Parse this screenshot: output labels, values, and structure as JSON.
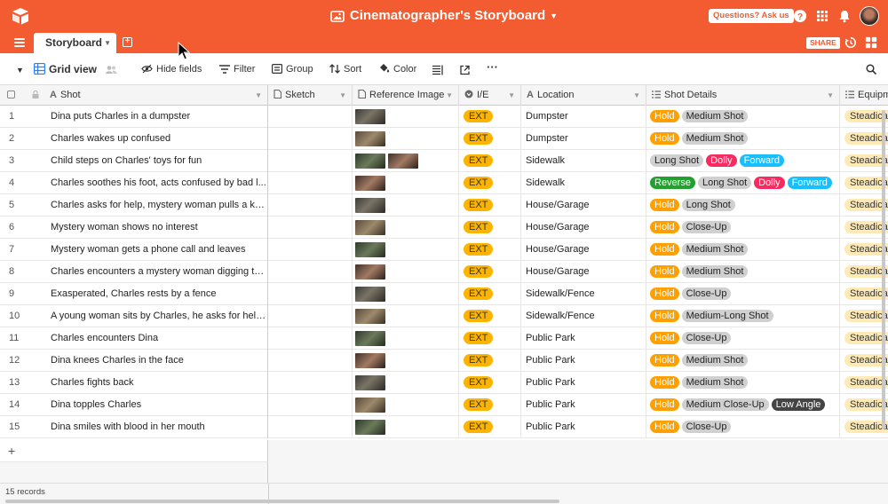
{
  "header": {
    "title": "Cinematographer's Storyboard",
    "questions_label": "Questions? Ask us",
    "share_label": "SHARE",
    "accent": "#f25c30"
  },
  "tabs": [
    {
      "label": "Storyboard"
    }
  ],
  "toolbar": {
    "view_name": "Grid view",
    "hide_fields": "Hide fields",
    "filter": "Filter",
    "group": "Group",
    "sort": "Sort",
    "color": "Color"
  },
  "columns": {
    "shot": "Shot",
    "sketch": "Sketch",
    "reference": "Reference Image",
    "ie": "I/E",
    "location": "Location",
    "details": "Shot Details",
    "equipment": "Equipm"
  },
  "rows": [
    {
      "num": "1",
      "shot": "Dina puts Charles in a dumpster",
      "ie": "EXT",
      "location": "Dumpster",
      "details": [
        {
          "text": "Hold",
          "c": "hold"
        },
        {
          "text": "Medium Shot",
          "c": "gray"
        }
      ],
      "equipment": "Steadicam",
      "thumbs": 1
    },
    {
      "num": "2",
      "shot": "Charles wakes up confused",
      "ie": "EXT",
      "location": "Dumpster",
      "details": [
        {
          "text": "Hold",
          "c": "hold"
        },
        {
          "text": "Medium Shot",
          "c": "gray"
        }
      ],
      "equipment": "Steadicam",
      "thumbs": 1
    },
    {
      "num": "3",
      "shot": "Child steps on Charles' toys for fun",
      "ie": "EXT",
      "location": "Sidewalk",
      "details": [
        {
          "text": "Long Shot",
          "c": "gray"
        },
        {
          "text": "Dolly",
          "c": "dolly"
        },
        {
          "text": "Forward",
          "c": "forward"
        }
      ],
      "equipment": "Steadicam",
      "thumbs": 2
    },
    {
      "num": "4",
      "shot": "Charles soothes his foot, acts confused by bad l...",
      "ie": "EXT",
      "location": "Sidewalk",
      "details": [
        {
          "text": "Reverse",
          "c": "reverse"
        },
        {
          "text": "Long Shot",
          "c": "gray"
        },
        {
          "text": "Dolly",
          "c": "dolly"
        },
        {
          "text": "Forward",
          "c": "forward"
        }
      ],
      "equipment": "Steadicam",
      "thumbs": 1
    },
    {
      "num": "5",
      "shot": "Charles asks for help, mystery woman pulls a kn...",
      "ie": "EXT",
      "location": "House/Garage",
      "details": [
        {
          "text": "Hold",
          "c": "hold"
        },
        {
          "text": "Long Shot",
          "c": "gray"
        }
      ],
      "equipment": "Steadicam",
      "thumbs": 1
    },
    {
      "num": "6",
      "shot": "Mystery woman shows no interest",
      "ie": "EXT",
      "location": "House/Garage",
      "details": [
        {
          "text": "Hold",
          "c": "hold"
        },
        {
          "text": "Close-Up",
          "c": "gray"
        }
      ],
      "equipment": "Steadicam",
      "thumbs": 1
    },
    {
      "num": "7",
      "shot": "Mystery woman gets a phone call and leaves",
      "ie": "EXT",
      "location": "House/Garage",
      "details": [
        {
          "text": "Hold",
          "c": "hold"
        },
        {
          "text": "Medium Shot",
          "c": "gray"
        }
      ],
      "equipment": "Steadicam",
      "thumbs": 1
    },
    {
      "num": "8",
      "shot": "Charles encounters a mystery woman digging th...",
      "ie": "EXT",
      "location": "House/Garage",
      "details": [
        {
          "text": "Hold",
          "c": "hold"
        },
        {
          "text": "Medium Shot",
          "c": "gray"
        }
      ],
      "equipment": "Steadicam",
      "thumbs": 1
    },
    {
      "num": "9",
      "shot": "Exasperated, Charles rests by a fence",
      "ie": "EXT",
      "location": "Sidewalk/Fence",
      "details": [
        {
          "text": "Hold",
          "c": "hold"
        },
        {
          "text": "Close-Up",
          "c": "gray"
        }
      ],
      "equipment": "Steadicam",
      "thumbs": 1
    },
    {
      "num": "10",
      "shot": "A young woman sits by Charles, he asks for help...",
      "ie": "EXT",
      "location": "Sidewalk/Fence",
      "details": [
        {
          "text": "Hold",
          "c": "hold"
        },
        {
          "text": "Medium-Long Shot",
          "c": "gray"
        }
      ],
      "equipment": "Steadicam",
      "thumbs": 1
    },
    {
      "num": "11",
      "shot": "Charles encounters Dina",
      "ie": "EXT",
      "location": "Public Park",
      "details": [
        {
          "text": "Hold",
          "c": "hold"
        },
        {
          "text": "Close-Up",
          "c": "gray"
        }
      ],
      "equipment": "Steadicam",
      "thumbs": 1
    },
    {
      "num": "12",
      "shot": "Dina knees Charles in the face",
      "ie": "EXT",
      "location": "Public Park",
      "details": [
        {
          "text": "Hold",
          "c": "hold"
        },
        {
          "text": "Medium Shot",
          "c": "gray"
        }
      ],
      "equipment": "Steadicam",
      "thumbs": 1
    },
    {
      "num": "13",
      "shot": "Charles fights back",
      "ie": "EXT",
      "location": "Public Park",
      "details": [
        {
          "text": "Hold",
          "c": "hold"
        },
        {
          "text": "Medium Shot",
          "c": "gray"
        }
      ],
      "equipment": "Steadicam",
      "thumbs": 1
    },
    {
      "num": "14",
      "shot": "Dina topples Charles",
      "ie": "EXT",
      "location": "Public Park",
      "details": [
        {
          "text": "Hold",
          "c": "hold"
        },
        {
          "text": "Medium Close-Up",
          "c": "gray"
        },
        {
          "text": "Low Angle",
          "c": "dark"
        }
      ],
      "equipment": "Steadicam",
      "thumbs": 1
    },
    {
      "num": "15",
      "shot": "Dina smiles with blood in her mouth",
      "ie": "EXT",
      "location": "Public Park",
      "details": [
        {
          "text": "Hold",
          "c": "hold"
        },
        {
          "text": "Close-Up",
          "c": "gray"
        }
      ],
      "equipment": "Steadicam",
      "thumbs": 1
    }
  ],
  "add_row_label": "+",
  "footer": {
    "records": "15 records"
  }
}
